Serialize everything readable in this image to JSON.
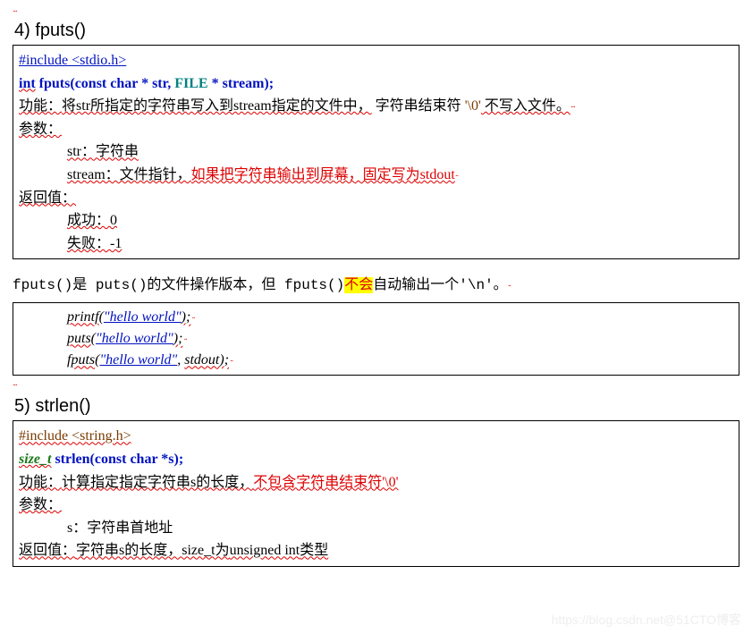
{
  "top_squiggle": "ᐧᐧᐧ",
  "section4": {
    "title": "4) fputs()",
    "include": "#include <stdio.h>",
    "sig_int": "int",
    "sig_fn": " fputs(",
    "sig_constchar": "const char",
    "sig_star_str": " * str, ",
    "sig_file": "FILE",
    "sig_star_stream": " * stream);",
    "func_label": "功能：",
    "func_text_a": "将str所指定的字符串写入到stream指定的文件中，",
    "func_text_b": " 字符串结束符 ",
    "null_char": "'\\0'",
    "func_text_c": " 不写入文件。",
    "params_label": "参数：",
    "param_str": "str：字符串",
    "param_stream_a": "stream：文件指针，",
    "param_stream_b": "如果把字符串输出到屏幕，固定写为",
    "param_stream_c": "stdout",
    "return_label": "返回值：",
    "ret_ok": "成功：0",
    "ret_fail": "失败：-1"
  },
  "between": {
    "text_a": "fputs()是 puts()的文件操作版本，但 fputs()",
    "text_hl": "不会",
    "text_b": "自动输出一个'\\n'。"
  },
  "codebox": {
    "l1a": "printf",
    "l1b": "(",
    "l1c": "\"hello world\"",
    "l1d": ");",
    "l2a": "puts",
    "l2b": "(",
    "l2c": "\"hello world\"",
    "l2d": ");",
    "l3a": "fputs",
    "l3b": "(",
    "l3c": "\"hello world\"",
    "l3d": ", ",
    "l3e": "stdout",
    "l3f": ");"
  },
  "section5": {
    "title": "5) strlen()",
    "include": "#include <string.h>",
    "sig_size_t": "size_t",
    "sig_fn": " strlen(",
    "sig_constchar": "const char",
    "sig_star_s": " *s);",
    "func_label": "功能：",
    "func_text_a": "计算指定指定字符串s的长度，",
    "func_text_b": "不包含字符串结束符'\\0'",
    "params_label": "参数：",
    "param_s": "s：字符串首地址",
    "return_label": "返回值：",
    "return_text_a": "字符串s的长度，size_t为",
    "return_text_b": "unsigned int",
    "return_text_c": "类型"
  },
  "watermark": "https://blog.csdn.net@51CTO博客"
}
